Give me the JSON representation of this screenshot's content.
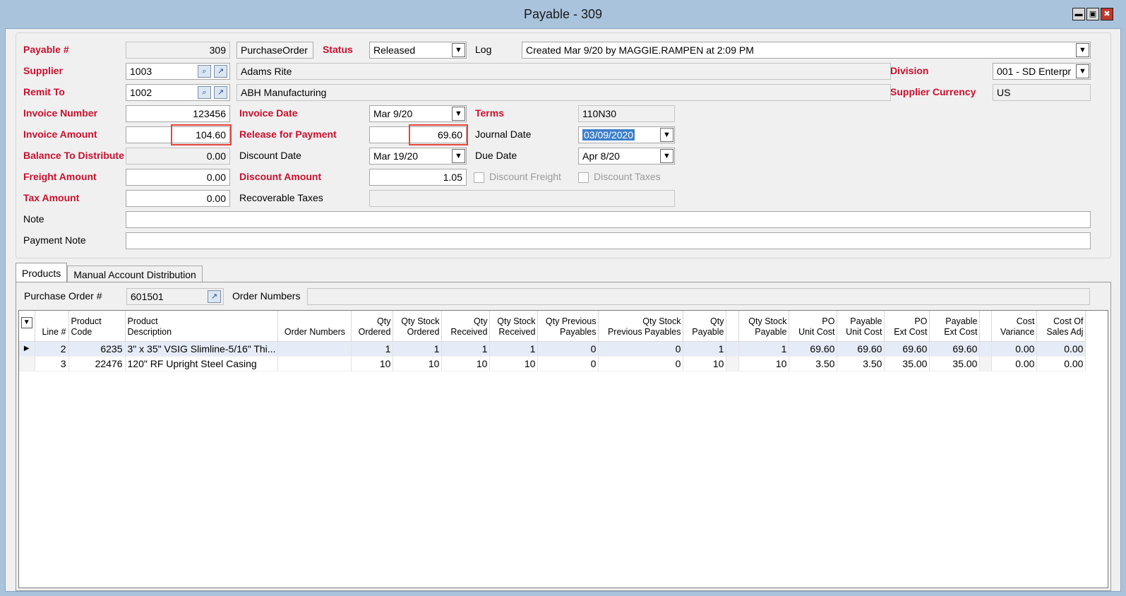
{
  "window": {
    "title": "Payable - 309",
    "minimize": "▬",
    "maximize": "▣",
    "close": "✖"
  },
  "header": {
    "payable_label": "Payable #",
    "payable_value": "309",
    "source_type": "PurchaseOrder",
    "status_label": "Status",
    "status_value": "Released",
    "log_label": "Log",
    "log_value": "Created Mar 9/20 by MAGGIE.RAMPEN at 2:09 PM",
    "supplier_label": "Supplier",
    "supplier_code": "1003",
    "supplier_name": "Adams Rite",
    "division_label": "Division",
    "division_value": "001 - SD Enterpr",
    "remit_label": "Remit To",
    "remit_code": "1002",
    "remit_name": "ABH Manufacturing",
    "currency_label": "Supplier Currency",
    "currency_value": "US",
    "invoice_number_label": "Invoice Number",
    "invoice_number_value": "123456",
    "invoice_date_label": "Invoice Date",
    "invoice_date_value": "Mar 9/20",
    "terms_label": "Terms",
    "terms_value": "110N30",
    "invoice_amount_label": "Invoice Amount",
    "invoice_amount_value": "104.60",
    "release_label": "Release for Payment",
    "release_value": "69.60",
    "journal_date_label": "Journal Date",
    "journal_date_value": "03/09/2020",
    "balance_label": "Balance To Distribute",
    "balance_value": "0.00",
    "discount_date_label": "Discount Date",
    "discount_date_value": "Mar 19/20",
    "due_date_label": "Due Date",
    "due_date_value": "Apr 8/20",
    "freight_label": "Freight Amount",
    "freight_value": "0.00",
    "discount_amount_label": "Discount Amount",
    "discount_amount_value": "1.05",
    "discount_freight_label": "Discount Freight",
    "discount_taxes_label": "Discount Taxes",
    "tax_label": "Tax Amount",
    "tax_value": "0.00",
    "recoverable_label": "Recoverable Taxes",
    "recoverable_value": "",
    "note_label": "Note",
    "note_value": "",
    "payment_note_label": "Payment Note",
    "payment_note_value": ""
  },
  "tabs": [
    {
      "label": "Products"
    },
    {
      "label": "Manual Account Distribution"
    }
  ],
  "products": {
    "po_label": "Purchase Order #",
    "po_value": "601501",
    "order_numbers_label": "Order Numbers",
    "order_numbers_value": "",
    "columns": [
      "Line #",
      "Product\nCode",
      "Product\nDescription",
      "Order Numbers",
      "Qty\nOrdered",
      "Qty Stock\nOrdered",
      "Qty\nReceived",
      "Qty Stock\nReceived",
      "Qty Previous\nPayables",
      "Qty Stock\nPrevious Payables",
      "Qty\nPayable",
      "Qty Stock\nPayable",
      "PO\nUnit Cost",
      "Payable\nUnit Cost",
      "PO\nExt Cost",
      "Payable\nExt Cost",
      "Cost\nVariance",
      "Cost Of\nSales Adj"
    ],
    "rows": [
      {
        "line": "2",
        "code": "6235",
        "desc": "3\" x 35\" VSIG Slimline-5/16\" Thi...",
        "orders": "",
        "qty_ord": "1",
        "qty_stock_ord": "1",
        "qty_rec": "1",
        "qty_stock_rec": "1",
        "qty_prev": "0",
        "qty_stock_prev": "0",
        "qty_pay": "1",
        "qty_stock_pay": "1",
        "po_unit": "69.60",
        "pay_unit": "69.60",
        "po_ext": "69.60",
        "pay_ext": "69.60",
        "variance": "0.00",
        "cos_adj": "0.00"
      },
      {
        "line": "3",
        "code": "22476",
        "desc": "120\" RF Upright Steel Casing",
        "orders": "",
        "qty_ord": "10",
        "qty_stock_ord": "10",
        "qty_rec": "10",
        "qty_stock_rec": "10",
        "qty_prev": "0",
        "qty_stock_prev": "0",
        "qty_pay": "10",
        "qty_stock_pay": "10",
        "po_unit": "3.50",
        "pay_unit": "3.50",
        "po_ext": "35.00",
        "pay_ext": "35.00",
        "variance": "0.00",
        "cos_adj": "0.00"
      }
    ]
  }
}
